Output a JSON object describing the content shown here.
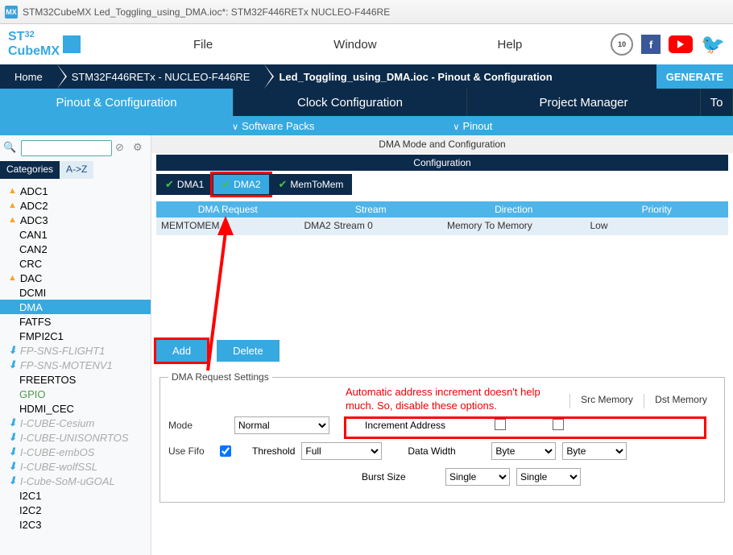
{
  "window_title": "STM32CubeMX Led_Toggling_using_DMA.ioc*: STM32F446RETx NUCLEO-F446RE",
  "logo": {
    "st": "ST",
    "num": "32",
    "cube": "CubeMX"
  },
  "menu": {
    "file": "File",
    "window": "Window",
    "help": "Help"
  },
  "badge": "10",
  "breadcrumb": {
    "home": "Home",
    "part": "STM32F446RETx  -  NUCLEO-F446RE",
    "proj": "Led_Toggling_using_DMA.ioc - Pinout & Configuration",
    "gen": "GENERATE"
  },
  "tabs": {
    "pinout": "Pinout & Configuration",
    "clock": "Clock Configuration",
    "project": "Project Manager",
    "tools": "To"
  },
  "subrow": {
    "packs": "Software Packs",
    "pinout": "Pinout"
  },
  "cattabs": {
    "cat": "Categories",
    "az": "A->Z"
  },
  "periphs": [
    {
      "label": "ADC1",
      "warn": true
    },
    {
      "label": "ADC2",
      "warn": true
    },
    {
      "label": "ADC3",
      "warn": true
    },
    {
      "label": "CAN1"
    },
    {
      "label": "CAN2"
    },
    {
      "label": "CRC"
    },
    {
      "label": "DAC",
      "warn": true
    },
    {
      "label": "DCMI"
    },
    {
      "label": "DMA",
      "sel": true
    },
    {
      "label": "FATFS"
    },
    {
      "label": "FMPI2C1"
    },
    {
      "label": "FP-SNS-FLIGHT1",
      "dl": true,
      "gray": true
    },
    {
      "label": "FP-SNS-MOTENV1",
      "dl": true,
      "gray": true
    },
    {
      "label": "FREERTOS"
    },
    {
      "label": "GPIO",
      "green": true
    },
    {
      "label": "HDMI_CEC"
    },
    {
      "label": "I-CUBE-Cesium",
      "dl": true,
      "gray": true
    },
    {
      "label": "I-CUBE-UNISONRTOS",
      "dl": true,
      "gray": true
    },
    {
      "label": "I-CUBE-embOS",
      "dl": true,
      "gray": true
    },
    {
      "label": "I-CUBE-wolfSSL",
      "dl": true,
      "gray": true
    },
    {
      "label": "I-Cube-SoM-uGOAL",
      "dl": true,
      "gray": true
    },
    {
      "label": "I2C1"
    },
    {
      "label": "I2C2"
    },
    {
      "label": "I2C3"
    }
  ],
  "content": {
    "hdr": "DMA Mode and Configuration",
    "cfg": "Configuration",
    "dmatabs": {
      "d1": "DMA1",
      "d2": "DMA2",
      "m2m": "MemToMem"
    },
    "thead": {
      "req": "DMA Request",
      "stream": "Stream",
      "dir": "Direction",
      "prio": "Priority"
    },
    "row": {
      "req": "MEMTOMEM",
      "stream": "DMA2 Stream 0",
      "dir": "Memory To Memory",
      "prio": "Low"
    },
    "buttons": {
      "add": "Add",
      "del": "Delete"
    },
    "settings_legend": "DMA Request Settings",
    "labels": {
      "mode": "Mode",
      "mode_val": "Normal",
      "usefifo": "Use Fifo",
      "threshold": "Threshold",
      "threshold_val": "Full",
      "inc": "Increment Address",
      "datawidth": "Data Width",
      "burst": "Burst Size",
      "src": "Src Memory",
      "dst": "Dst Memory",
      "byte": "Byte",
      "single": "Single"
    },
    "anno": "Automatic address increment doesn't help much. So, disable these options."
  }
}
